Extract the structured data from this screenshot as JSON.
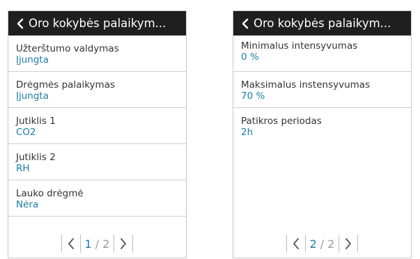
{
  "colors": {
    "header_bg": "#1f1f1f",
    "value": "#1a7fa6",
    "label": "#333333"
  },
  "panels": [
    {
      "title": "Oro kokybės palaikym...",
      "items": [
        {
          "label": "Užterštumo valdymas",
          "value": "Įjungta"
        },
        {
          "label": "Drėgmės palaikymas",
          "value": "Įjungta"
        },
        {
          "label": "Jutiklis 1",
          "value": "CO2"
        },
        {
          "label": "Jutiklis 2",
          "value": "RH"
        },
        {
          "label": "Lauko drėgmė",
          "value": "Nėra"
        }
      ],
      "pager": {
        "current": "1",
        "sep": "/",
        "total": "2"
      }
    },
    {
      "title": "Oro kokybės palaikym...",
      "items": [
        {
          "label": "Minimalus intensyvumas",
          "value": "0 %"
        },
        {
          "label": "Maksimalus instensyvumas",
          "value": "70 %"
        },
        {
          "label": "Patikros periodas",
          "value": "2h"
        }
      ],
      "pager": {
        "current": "2",
        "sep": "/",
        "total": "2"
      }
    }
  ]
}
